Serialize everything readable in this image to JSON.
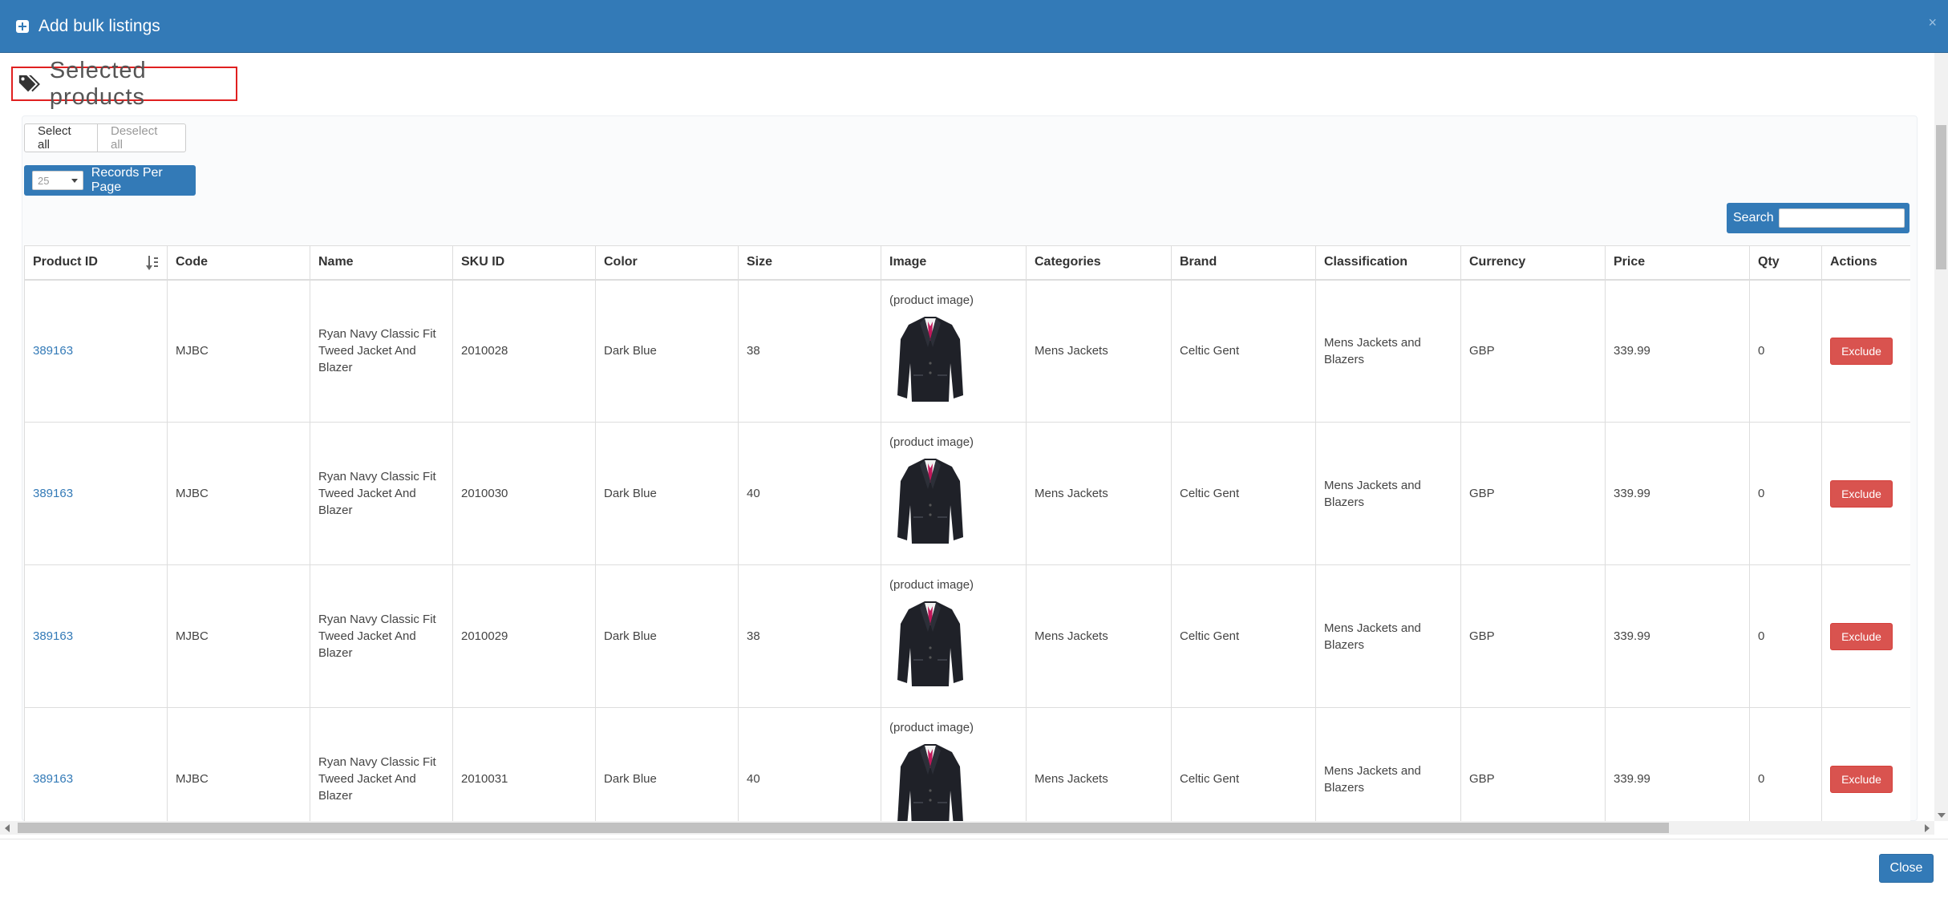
{
  "modal": {
    "title": "Add bulk listings",
    "close_x": "×"
  },
  "section": {
    "title": "Selected products"
  },
  "selection": {
    "select_all": "Select all",
    "deselect_all": "Deselect all"
  },
  "pagination": {
    "per_page_value": "25",
    "per_page_label": "Records Per Page"
  },
  "search": {
    "label": "Search",
    "value": ""
  },
  "table": {
    "headers": [
      "Product ID",
      "Code",
      "Name",
      "SKU ID",
      "Color",
      "Size",
      "Image",
      "Categories",
      "Brand",
      "Classification",
      "Currency",
      "Price",
      "Qty",
      "Actions"
    ],
    "rows": [
      {
        "product_id": "389163",
        "code": "MJBC",
        "name": "Ryan Navy Classic Fit Tweed Jacket And Blazer",
        "sku_id": "2010028",
        "color": "Dark Blue",
        "size": "38",
        "image_alt": "(product image)",
        "categories": "Mens Jackets",
        "brand": "Celtic Gent",
        "classification": "Mens Jackets and Blazers",
        "currency": "GBP",
        "price": "339.99",
        "qty": "0",
        "action": "Exclude"
      },
      {
        "product_id": "389163",
        "code": "MJBC",
        "name": "Ryan Navy Classic Fit Tweed Jacket And Blazer",
        "sku_id": "2010030",
        "color": "Dark Blue",
        "size": "40",
        "image_alt": "(product image)",
        "categories": "Mens Jackets",
        "brand": "Celtic Gent",
        "classification": "Mens Jackets and Blazers",
        "currency": "GBP",
        "price": "339.99",
        "qty": "0",
        "action": "Exclude"
      },
      {
        "product_id": "389163",
        "code": "MJBC",
        "name": "Ryan Navy Classic Fit Tweed Jacket And Blazer",
        "sku_id": "2010029",
        "color": "Dark Blue",
        "size": "38",
        "image_alt": "(product image)",
        "categories": "Mens Jackets",
        "brand": "Celtic Gent",
        "classification": "Mens Jackets and Blazers",
        "currency": "GBP",
        "price": "339.99",
        "qty": "0",
        "action": "Exclude"
      },
      {
        "product_id": "389163",
        "code": "MJBC",
        "name": "Ryan Navy Classic Fit Tweed Jacket And Blazer",
        "sku_id": "2010031",
        "color": "Dark Blue",
        "size": "40",
        "image_alt": "(product image)",
        "categories": "Mens Jackets",
        "brand": "Celtic Gent",
        "classification": "Mens Jackets and Blazers",
        "currency": "GBP",
        "price": "339.99",
        "qty": "0",
        "action": "Exclude"
      }
    ]
  },
  "footer": {
    "close_label": "Close"
  },
  "colors": {
    "primary": "#337ab7",
    "danger": "#d9534f",
    "highlight_border": "#e02020",
    "link": "#337ab7"
  },
  "icons": {
    "header": "plus-square-icon",
    "section": "tags-icon",
    "sort": "sort-ascending-icon",
    "product": "jacket-icon"
  }
}
